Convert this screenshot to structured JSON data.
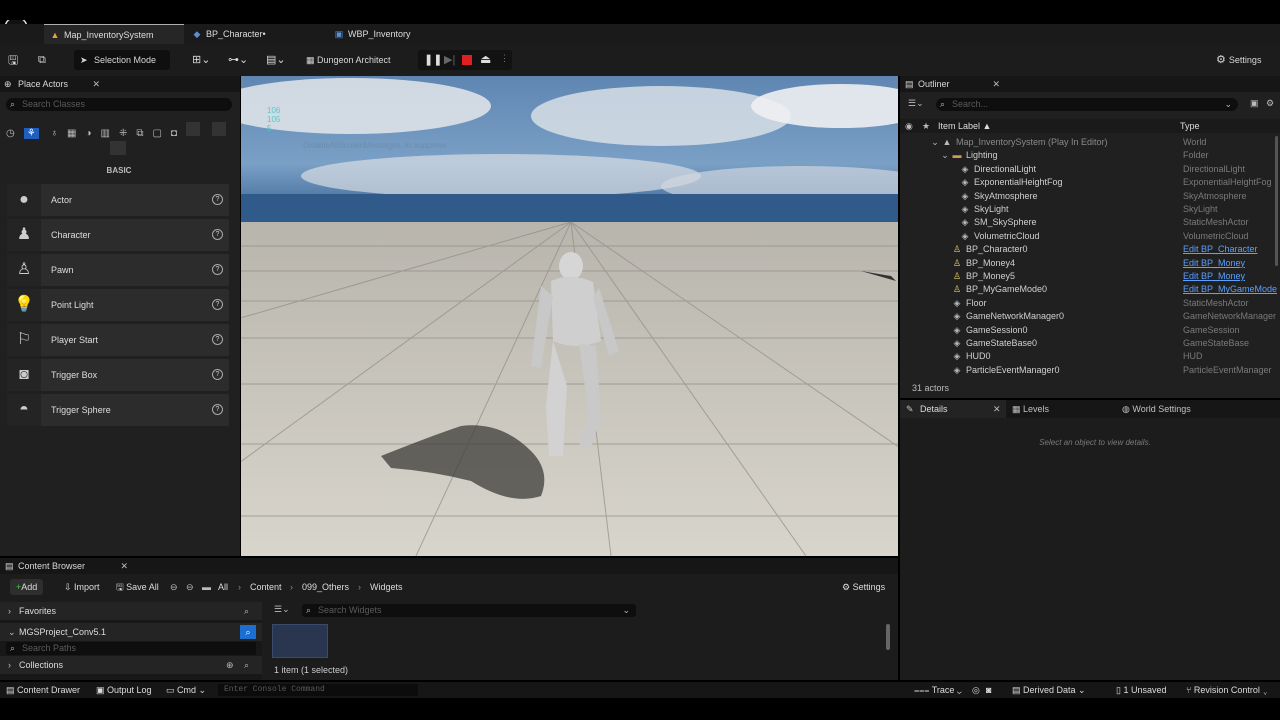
{
  "tabs": [
    {
      "label": "Map_InventorySystem",
      "icon": "level-icon"
    },
    {
      "label": "BP_Character•",
      "icon": "blueprint-icon"
    },
    {
      "label": "WBP_Inventory",
      "icon": "widget-blueprint-icon"
    }
  ],
  "toolbar": {
    "selection_mode": "Selection Mode",
    "dungeon_architect": "Dungeon Architect",
    "settings": "Settings"
  },
  "place_actors": {
    "title": "Place Actors",
    "search_placeholder": "Search Classes",
    "category": "BASIC",
    "items": [
      {
        "label": "Actor",
        "icon": "sphere-icon"
      },
      {
        "label": "Character",
        "icon": "character-icon"
      },
      {
        "label": "Pawn",
        "icon": "pawn-icon"
      },
      {
        "label": "Point Light",
        "icon": "light-bulb-icon"
      },
      {
        "label": "Player Start",
        "icon": "player-start-icon"
      },
      {
        "label": "Trigger Box",
        "icon": "trigger-box-icon"
      },
      {
        "label": "Trigger Sphere",
        "icon": "trigger-sphere-icon"
      }
    ]
  },
  "viewport": {
    "stats": [
      "106",
      "105",
      "5"
    ],
    "message": "DisableAllScreenMessages, to suppress"
  },
  "outliner": {
    "title": "Outliner",
    "search_placeholder": "Search...",
    "col_label": "Item Label ▲",
    "col_type": "Type",
    "rows": [
      {
        "name": "Map_InventorySystem (Play In Editor)",
        "type": "World",
        "link": false,
        "indent": 0
      },
      {
        "name": "Lighting",
        "type": "Folder",
        "link": false,
        "indent": 1
      },
      {
        "name": "DirectionalLight",
        "type": "DirectionalLight",
        "link": false,
        "indent": 2
      },
      {
        "name": "ExponentialHeightFog",
        "type": "ExponentialHeightFog",
        "link": false,
        "indent": 2
      },
      {
        "name": "SkyAtmosphere",
        "type": "SkyAtmosphere",
        "link": false,
        "indent": 2
      },
      {
        "name": "SkyLight",
        "type": "SkyLight",
        "link": false,
        "indent": 2
      },
      {
        "name": "SM_SkySphere",
        "type": "StaticMeshActor",
        "link": false,
        "indent": 2
      },
      {
        "name": "VolumetricCloud",
        "type": "VolumetricCloud",
        "link": false,
        "indent": 2
      },
      {
        "name": "BP_Character0",
        "type": "Edit BP_Character",
        "link": true,
        "indent": 1
      },
      {
        "name": "BP_Money4",
        "type": "Edit BP_Money",
        "link": true,
        "indent": 1
      },
      {
        "name": "BP_Money5",
        "type": "Edit BP_Money",
        "link": true,
        "indent": 1
      },
      {
        "name": "BP_MyGameMode0",
        "type": "Edit BP_MyGameMode",
        "link": true,
        "indent": 1
      },
      {
        "name": "Floor",
        "type": "StaticMeshActor",
        "link": false,
        "indent": 1
      },
      {
        "name": "GameNetworkManager0",
        "type": "GameNetworkManager",
        "link": false,
        "indent": 1
      },
      {
        "name": "GameSession0",
        "type": "GameSession",
        "link": false,
        "indent": 1
      },
      {
        "name": "GameStateBase0",
        "type": "GameStateBase",
        "link": false,
        "indent": 1
      },
      {
        "name": "HUD0",
        "type": "HUD",
        "link": false,
        "indent": 1
      },
      {
        "name": "ParticleEventManager0",
        "type": "ParticleEventManager",
        "link": false,
        "indent": 1
      }
    ],
    "count": "31 actors"
  },
  "details": {
    "tab": "Details",
    "levels": "Levels",
    "world_settings": "World Settings",
    "empty": "Select an object to view details."
  },
  "content_browser": {
    "title": "Content Browser",
    "add": "Add",
    "import": "Import",
    "save_all": "Save All",
    "crumbs": [
      "All",
      "Content",
      "099_Others",
      "Widgets"
    ],
    "settings": "Settings",
    "favorites": "Favorites",
    "project": "MGSProject_Conv5.1",
    "search_paths": "Search Paths",
    "collections": "Collections",
    "search_widgets": "Search Widgets",
    "status": "1 item (1 selected)"
  },
  "statusbar": {
    "content_drawer": "Content Drawer",
    "output_log": "Output Log",
    "cmd": "Cmd",
    "console_placeholder": "Enter Console Command",
    "trace": "Trace",
    "derived_data": "Derived Data",
    "unsaved": "1 Unsaved",
    "revision_control": "Revision Control"
  }
}
